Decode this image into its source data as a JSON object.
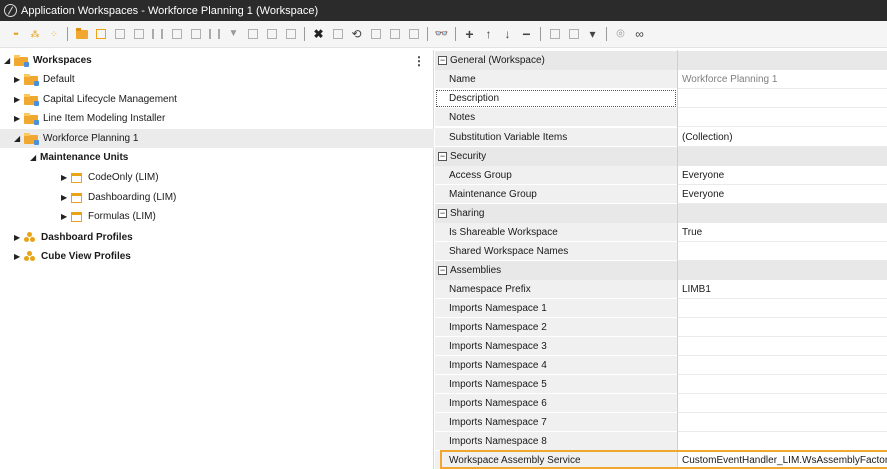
{
  "window": {
    "title": "Application Workspaces - Workforce Planning 1 (Workspace)"
  },
  "toolbar": {
    "icons": [
      "expand-icon",
      "group-icon",
      "add-group-icon",
      "folder-icon",
      "unit-icon",
      "chart-icon",
      "grid-icon",
      "bars-icon",
      "list-icon",
      "table-icon",
      "columns-icon",
      "filter-icon",
      "doc-icon",
      "doc2-icon",
      "copy-icon",
      "delete-icon",
      "edit-icon",
      "refresh-icon",
      "save-icon",
      "copy2-icon",
      "paste-icon",
      "search-icon",
      "add-icon",
      "up-icon",
      "down-icon",
      "remove-icon",
      "page-icon",
      "dropdown-icon",
      "view-icon",
      "link-icon"
    ],
    "glyphs": {
      "x": "✖",
      "refresh": "⟲",
      "save": "▭",
      "bino": "👓",
      "plus": "+",
      "up": "↑",
      "down": "↓",
      "minus": "−",
      "dd": "▾",
      "link": "∞"
    }
  },
  "tree": {
    "root": "Workspaces",
    "items": {
      "default": "Default",
      "clm": "Capital Lifecycle Management",
      "lim": "Line Item Modeling Installer",
      "wfp": "Workforce Planning 1",
      "mu": "Maintenance Units",
      "codeonly": "CodeOnly (LIM)",
      "dashboarding": "Dashboarding (LIM)",
      "formulas": "Formulas (LIM)",
      "dp": "Dashboard Profiles",
      "cvp": "Cube View Profiles"
    },
    "menu_glyph": "⋮",
    "expanded_glyph": "◢",
    "collapsed_glyph": "▶"
  },
  "properties": {
    "categories": {
      "general": "General (Workspace)",
      "security": "Security",
      "sharing": "Sharing",
      "assemblies": "Assemblies"
    },
    "rows": {
      "name": {
        "label": "Name",
        "value": "Workforce Planning 1"
      },
      "description": {
        "label": "Description",
        "value": ""
      },
      "notes": {
        "label": "Notes",
        "value": ""
      },
      "subvars": {
        "label": "Substitution Variable Items",
        "value": "(Collection)"
      },
      "access": {
        "label": "Access Group",
        "value": "Everyone"
      },
      "maint": {
        "label": "Maintenance Group",
        "value": "Everyone"
      },
      "shareable": {
        "label": "Is Shareable Workspace",
        "value": "True"
      },
      "shared_names": {
        "label": "Shared Workspace Names",
        "value": ""
      },
      "ns_prefix": {
        "label": "Namespace Prefix",
        "value": "LIMB1"
      },
      "imp1": {
        "label": "Imports Namespace 1",
        "value": ""
      },
      "imp2": {
        "label": "Imports Namespace 2",
        "value": ""
      },
      "imp3": {
        "label": "Imports Namespace 3",
        "value": ""
      },
      "imp4": {
        "label": "Imports Namespace 4",
        "value": ""
      },
      "imp5": {
        "label": "Imports Namespace 5",
        "value": ""
      },
      "imp6": {
        "label": "Imports Namespace 6",
        "value": ""
      },
      "imp7": {
        "label": "Imports Namespace 7",
        "value": ""
      },
      "imp8": {
        "label": "Imports Namespace 8",
        "value": ""
      },
      "wsas": {
        "label": "Workspace Assembly Service",
        "value": "CustomEventHandler_LIM.WsAssemblyFactory"
      }
    },
    "collapse_glyph": "−"
  },
  "colors": {
    "titlebar": "#2b2b2b",
    "accent": "#f0a830",
    "category_bg": "#e8e8e8",
    "name_col_bg": "#f0f0f0"
  }
}
